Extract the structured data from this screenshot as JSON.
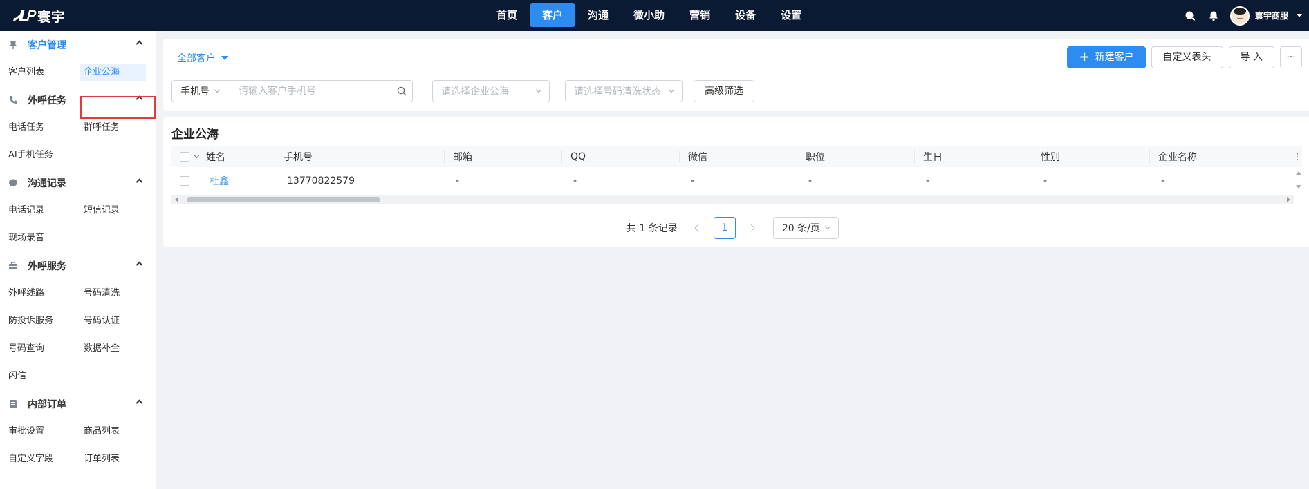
{
  "brand": {
    "logo_mark": "ᏗᏞᏢ",
    "name": "寰宇"
  },
  "nav": [
    {
      "label": "首页"
    },
    {
      "label": "客户",
      "active": true
    },
    {
      "label": "沟通"
    },
    {
      "label": "微小助"
    },
    {
      "label": "营销"
    },
    {
      "label": "设备"
    },
    {
      "label": "设置"
    }
  ],
  "user": {
    "name": "寰宇商服"
  },
  "sidebar": {
    "groups": [
      {
        "title": "客户管理",
        "icon": "pin-icon",
        "items": [
          "客户列表",
          "企业公海"
        ]
      },
      {
        "title": "外呼任务",
        "icon": "phone-icon",
        "items": [
          "电话任务",
          "群呼任务",
          "AI手机任务"
        ]
      },
      {
        "title": "沟通记录",
        "icon": "chat-icon",
        "items": [
          "电话记录",
          "短信记录",
          "现场录音"
        ]
      },
      {
        "title": "外呼服务",
        "icon": "briefcase-icon",
        "items": [
          "外呼线路",
          "号码清洗",
          "防投诉服务",
          "号码认证",
          "号码查询",
          "数据补全",
          "闪信"
        ]
      },
      {
        "title": "内部订单",
        "icon": "order-icon",
        "items": [
          "审批设置",
          "商品列表",
          "自定义字段",
          "订单列表"
        ]
      }
    ],
    "selected": "企业公海"
  },
  "toolbar": {
    "all_customers": "全部客户",
    "new_customer": "新建客户",
    "custom_header": "自定义表头",
    "import": "导 入",
    "more": "···"
  },
  "filters": {
    "phone_select": "手机号",
    "phone_placeholder": "请输入客户手机号",
    "sea_placeholder": "请选择企业公海",
    "clean_placeholder": "请选择号码清洗状态",
    "advanced": "高级筛选"
  },
  "table": {
    "title": "企业公海",
    "columns": [
      "姓名",
      "手机号",
      "邮箱",
      "QQ",
      "微信",
      "职位",
      "生日",
      "性别",
      "企业名称"
    ],
    "rows": [
      [
        "杜鑫",
        "13770822579",
        "-",
        "-",
        "-",
        "-",
        "-",
        "-",
        "-"
      ]
    ]
  },
  "pagination": {
    "total_text": "共 1 条记录",
    "current": "1",
    "page_size": "20 条/页"
  },
  "colors": {
    "primary": "#2d8cf0",
    "topbar": "#0b1a33",
    "highlight_border": "#e23b3b"
  }
}
